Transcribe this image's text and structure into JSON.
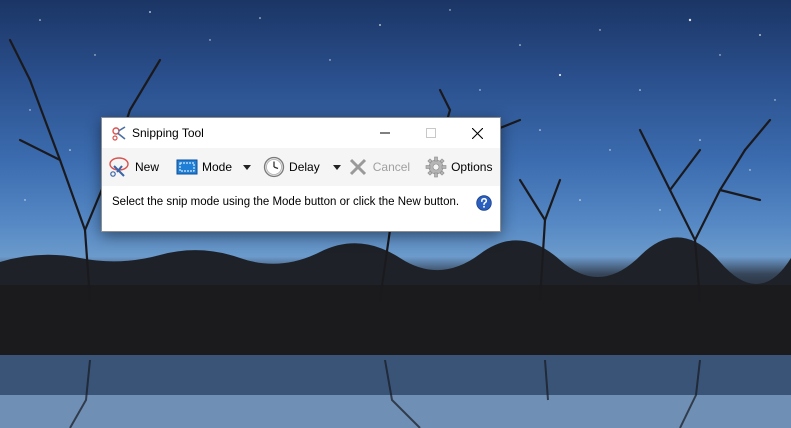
{
  "window": {
    "title": "Snipping Tool"
  },
  "toolbar": {
    "new_label": "New",
    "mode_label": "Mode",
    "delay_label": "Delay",
    "cancel_label": "Cancel",
    "options_label": "Options"
  },
  "message": "Select the snip mode using the Mode button or click the New button.",
  "icons": {
    "app": "scissors-icon",
    "new": "scissors-icon",
    "mode": "rectangle-snip-icon",
    "delay": "clock-icon",
    "cancel": "x-icon",
    "options": "gear-icon",
    "help": "help-icon"
  },
  "colors": {
    "accent": "#1f7fd6",
    "disabled_text": "#a0a0a0",
    "toolbar_bg": "#f5f5f5",
    "help_blue": "#2b5fbf"
  }
}
